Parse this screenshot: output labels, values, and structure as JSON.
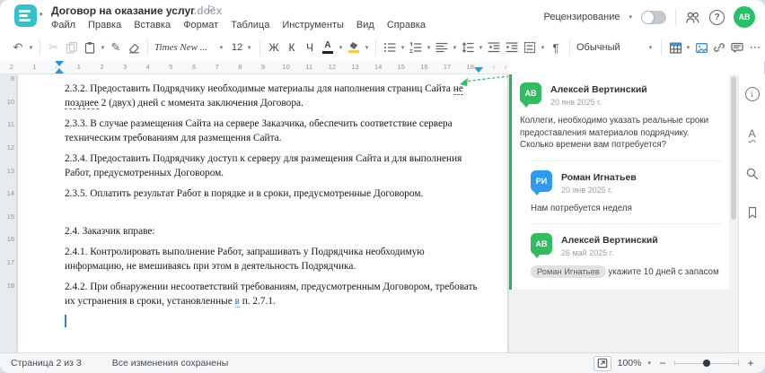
{
  "window": {
    "title": "Договор на оказание услуг",
    "title_ext": ".docx"
  },
  "menu": [
    "Файл",
    "Правка",
    "Вставка",
    "Формат",
    "Таблица",
    "Инструменты",
    "Вид",
    "Справка"
  ],
  "header": {
    "review_label": "Рецензирование",
    "avatar_initials": "АВ"
  },
  "icons": {
    "caret": "▾",
    "more": "⋯",
    "undo": "↶",
    "cut": "✂",
    "format_painter": "✎",
    "flag": "⚐",
    "pilcrow": "¶",
    "spellcheck_letter": "А",
    "info_letter": "i",
    "help_mark": "?"
  },
  "toolbar": {
    "font_name": "Times New ...",
    "font_size": "12",
    "style_name": "Обычный",
    "bold_letter": "Ж",
    "italic_letter": "К",
    "underline_letter": "Ч",
    "font_color_letter": "А"
  },
  "ruler": {
    "margin_numbers": [
      "2",
      "1"
    ],
    "numbers": [
      "1",
      "2",
      "3",
      "4",
      "5",
      "6",
      "7",
      "8",
      "9",
      "10",
      "11",
      "12",
      "13",
      "14",
      "15",
      "16",
      "17",
      "18"
    ],
    "vertical_numbers": [
      "9",
      "10",
      "11",
      "12",
      "13",
      "14",
      "15",
      "16",
      "17",
      "18"
    ]
  },
  "document": {
    "p1_before": "2.3.2. Предоставить Подрядчику необходимые материалы для наполнения страниц Сайта ",
    "p1_anchor": "не позднее",
    "p1_after": " 2 (двух) дней с момента заключения Договора.",
    "p2": "2.3.3. В случае размещения Сайта на сервере Заказчика, обеспечить соответствие сервера техническим требованиям для размещения Сайта.",
    "p3": "2.3.4. Предоставить Подрядчику доступ к серверу для размещения Сайта и для выполнения Работ, предусмотренных Договором.",
    "p4": "2.3.5. Оплатить результат Работ в порядке и в сроки, предусмотренные Договором.",
    "p5": "2.4. Заказчик вправе:",
    "p6": "2.4.1. Контролировать выполнение Работ, запрашивать у Подрядчика необходимую информацию, не вмешиваясь при этом в деятельность Подрядчика.",
    "p7_before": "2.4.2. При обнаружении несоответствий требованиям, предусмотренным Договором, требовать их устранения в сроки, установленные ",
    "p7_marked": "в",
    "p7_after": " п. 2.7.1."
  },
  "comments": {
    "c1": {
      "initials": "АВ",
      "name": "Алексей Вертинский",
      "date": "20 янв 2025 г.",
      "text": "Коллеги, необходимо указать реальные сроки предоставления материалов подрядчику. Сколько времени вам потребуется?"
    },
    "c2": {
      "initials": "РИ",
      "name": "Роман Игнатьев",
      "date": "20 янв 2025 г.",
      "text": "Нам потребуется неделя"
    },
    "c3": {
      "initials": "АВ",
      "name": "Алексей Вертинский",
      "date": "26 май 2025 г.",
      "mention": "Роман Игнатьев",
      "text": " укажите 10 дней с запасом"
    }
  },
  "status_bar": {
    "page_info": "Страница 2 из 3",
    "save_status": "Все изменения сохранены",
    "zoom_value": "100%",
    "zoom_out": "−",
    "zoom_in": "+"
  },
  "colors": {
    "accent_teal": "#35c1cb",
    "comment_green": "#2fbd5f",
    "reply_blue": "#2e9af0",
    "marker_blue": "#1e9bda",
    "avatar_green": "#27c268",
    "toolbar_blue": "#3f91d2",
    "highlight_yellow": "#f3cf45"
  }
}
